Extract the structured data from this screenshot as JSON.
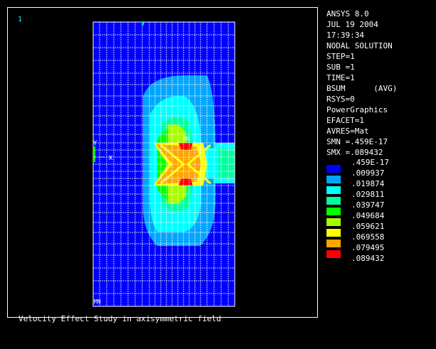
{
  "window_number": "1",
  "footer_title": "Velocity Effect Study in axisymmetric field",
  "info": [
    "ANSYS 8.0",
    "JUL 19 2004",
    "17:39:34",
    "NODAL SOLUTION",
    "STEP=1",
    "SUB =1",
    "TIME=1",
    "BSUM      (AVG)",
    "RSYS=0",
    "PowerGraphics",
    "EFACET=1",
    "AVRES=Mat",
    "SMN =.459E-17",
    "SMX =.089432"
  ],
  "legend": {
    "values": [
      ".459E-17",
      ".009937",
      ".019874",
      ".029811",
      ".039747",
      ".049684",
      ".059621",
      ".069558",
      ".079495",
      ".089432"
    ],
    "colors": [
      "#0000ff",
      "#00a5ff",
      "#00ffff",
      "#00ffa0",
      "#00ff00",
      "#a5ff00",
      "#ffff00",
      "#ffa500",
      "#ff0000"
    ]
  },
  "plot_labels": {
    "mx": "MX",
    "mn": "MN",
    "y_axis": "Y",
    "x_axis": "X"
  }
}
